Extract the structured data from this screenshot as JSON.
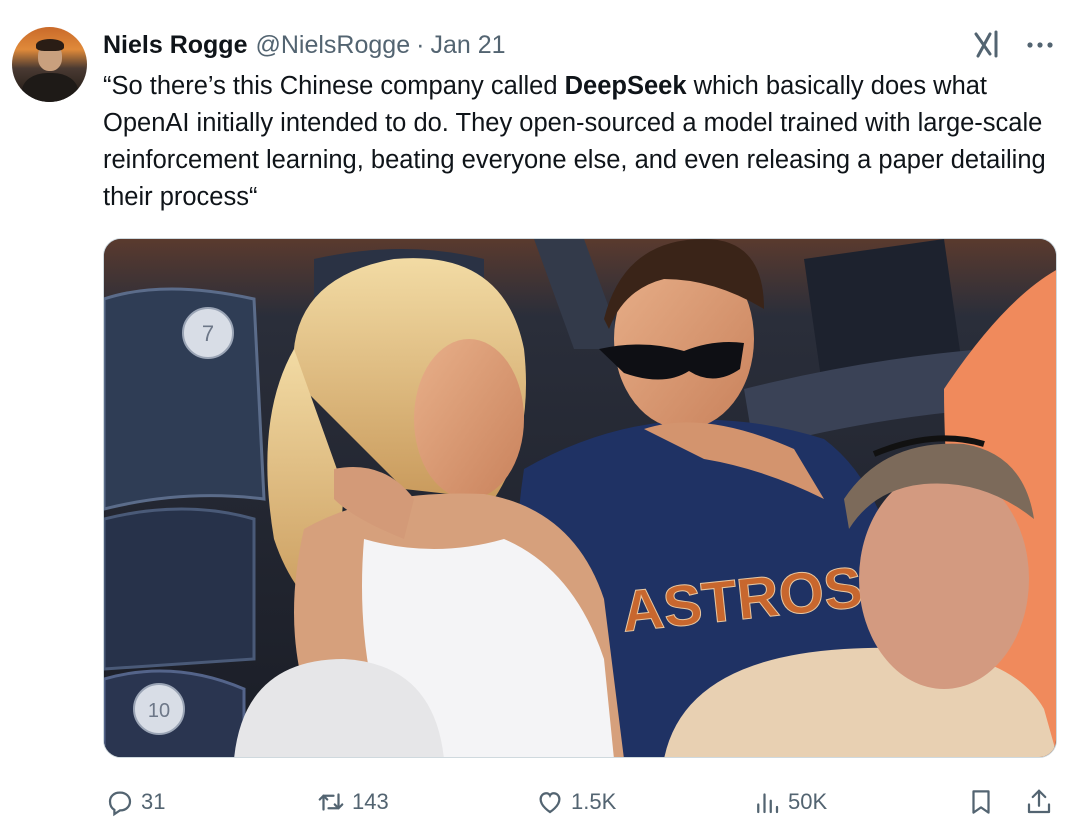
{
  "author": {
    "name": "Niels Rogge",
    "handle": "@NielsRogge",
    "separator": "·",
    "date": "Jan 21"
  },
  "tweet": {
    "text_before": "“So there’s this Chinese company called ",
    "text_bold": "DeepSeek",
    "text_after": " which basically does what OpenAI initially intended to do. They open-sourced a model trained with large-scale reinforcement learning, beating everyone else, and even releasing a paper detailing their process“"
  },
  "media": {
    "shirt_text": "ASTROS",
    "seat_numbers": [
      "7",
      "10"
    ]
  },
  "actions": {
    "replies": "31",
    "reposts": "143",
    "likes": "1.5K",
    "views": "50K"
  },
  "icons": {
    "grok": "grok-icon",
    "more": "more-icon",
    "reply": "reply-icon",
    "repost": "repost-icon",
    "like": "heart-icon",
    "views": "views-icon",
    "bookmark": "bookmark-icon",
    "share": "share-icon"
  },
  "colors": {
    "text": "#0f1419",
    "secondary": "#536471",
    "border": "#cfd9de"
  }
}
